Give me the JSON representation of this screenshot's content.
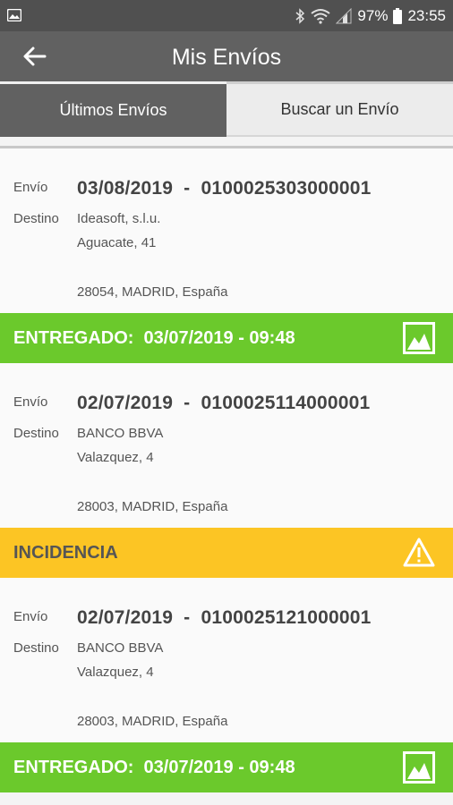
{
  "status_bar": {
    "battery": "97%",
    "time": "23:55",
    "icons": [
      "photo-icon",
      "bluetooth-icon",
      "wifi-icon",
      "signal-icon",
      "battery-icon"
    ]
  },
  "app_bar": {
    "title": "Mis Envíos",
    "back_icon": "arrow-left-icon"
  },
  "tabs": [
    {
      "label": "Últimos Envíos",
      "active": true
    },
    {
      "label": "Buscar un Envío",
      "active": false
    }
  ],
  "labels": {
    "envio": "Envío",
    "destino": "Destino"
  },
  "shipments": [
    {
      "date": "03/08/2019",
      "number": "0100025303000001",
      "dest_name": "Ideasoft, s.l.u.",
      "dest_street": "Aguacate, 41",
      "dest_city": "28054, MADRID, España",
      "status_text": "ENTREGADO:  03/07/2019 - 09:48",
      "status_type": "delivered",
      "status_icon": "image-icon"
    },
    {
      "date": "02/07/2019",
      "number": "0100025114000001",
      "dest_name": "BANCO BBVA",
      "dest_street": "Valazquez, 4",
      "dest_city": "28003, MADRID, España",
      "status_text": "INCIDENCIA",
      "status_type": "incident",
      "status_icon": "warning-icon"
    },
    {
      "date": "02/07/2019",
      "number": "0100025121000001",
      "dest_name": "BANCO BBVA",
      "dest_street": "Valazquez, 4",
      "dest_city": "28003, MADRID, España",
      "status_text": "ENTREGADO:  03/07/2019 - 09:48",
      "status_type": "delivered",
      "status_icon": "image-icon"
    }
  ],
  "colors": {
    "app_bar": "#616161",
    "delivered": "#6bc92c",
    "incident": "#fcc524"
  }
}
